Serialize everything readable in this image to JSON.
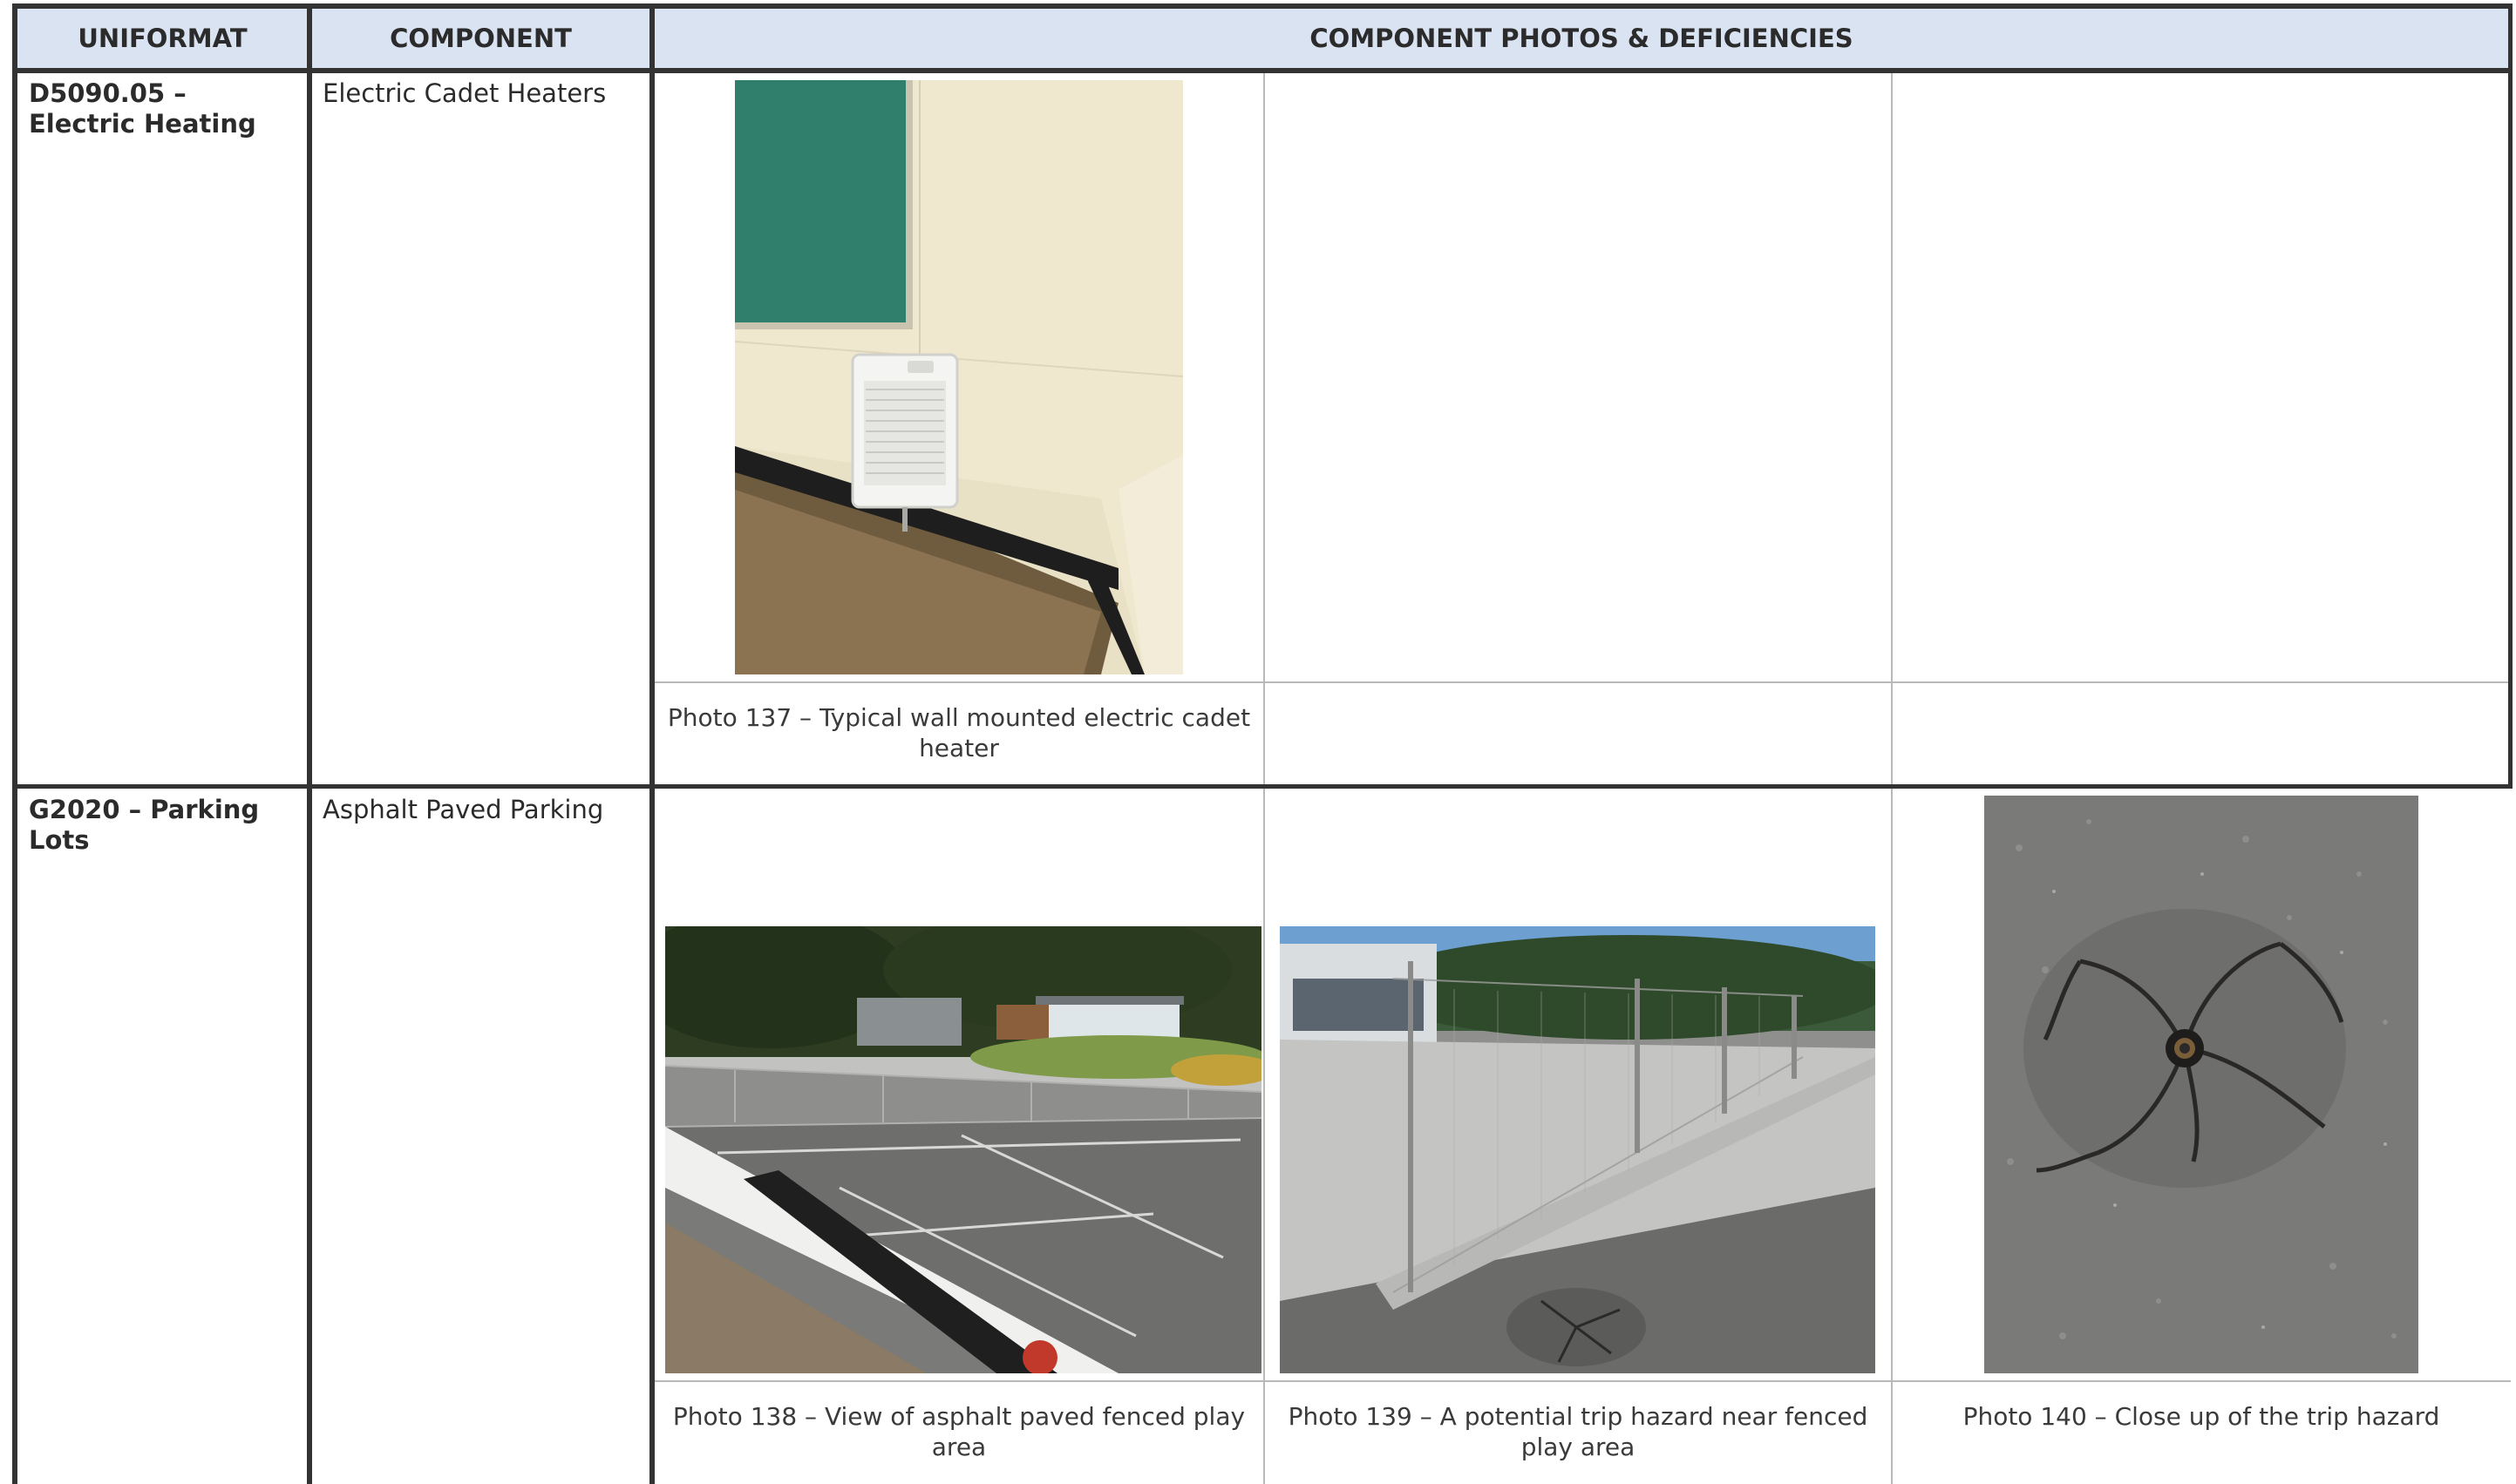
{
  "table": {
    "headers": [
      "UNIFORMAT",
      "COMPONENT",
      "COMPONENT PHOTOS & DEFICIENCIES"
    ],
    "rows": [
      {
        "uniformat": "D5090.05 – Electric Heating",
        "component": "Electric Cadet Heaters",
        "photos": [
          {
            "caption": "Photo 137 – Typical wall mounted electric cadet heater",
            "subject": "wall-mounted electric cadet heater"
          },
          {
            "caption": "",
            "subject": ""
          },
          {
            "caption": "",
            "subject": ""
          }
        ]
      },
      {
        "uniformat": "G2020 – Parking Lots",
        "component": "Asphalt Paved Parking",
        "photos": [
          {
            "caption": "Photo 138 – View of asphalt paved fenced play area",
            "subject": "asphalt fenced play area"
          },
          {
            "caption": "Photo 139 – A potential trip hazard near fenced play area",
            "subject": "trip hazard near fence"
          },
          {
            "caption": "Photo 140 – Close up of the trip hazard",
            "subject": "cracked asphalt close-up"
          }
        ]
      }
    ]
  },
  "colors": {
    "header_bg": "#d9e3f2",
    "border": "#333333",
    "grid_line": "#b9b9b9"
  }
}
